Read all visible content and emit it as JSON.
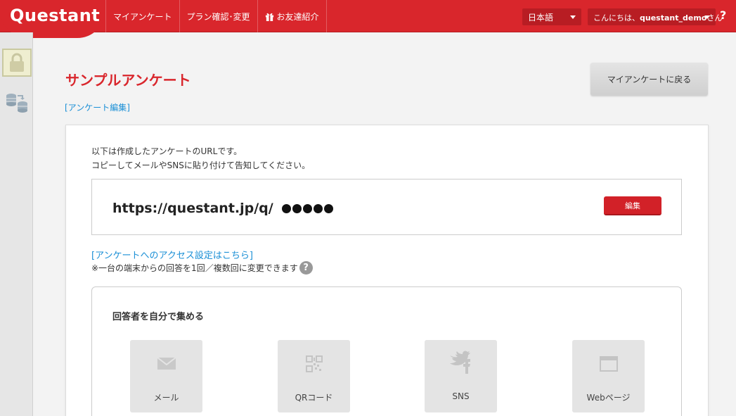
{
  "header": {
    "logo": "Questant",
    "nav": [
      {
        "label": "マイアンケート"
      },
      {
        "label": "プラン確認･変更"
      },
      {
        "label": "お友達紹介"
      }
    ],
    "language": "日本語",
    "user_greeting_prefix": "こんにちは、",
    "user_name": "questant_demo",
    "user_greeting_suffix": "さん",
    "help": "?"
  },
  "sidebar": {
    "items": [
      {
        "icon": "lock-icon"
      },
      {
        "icon": "database-transfer-icon"
      }
    ]
  },
  "main": {
    "title": "サンプルアンケート",
    "edit_link": "[アンケート編集]",
    "back_button": "マイアンケートに戻る",
    "intro_line1": "以下は作成したアンケートのURLです。",
    "intro_line2": "コピーしてメールやSNSに貼り付けて告知してください。",
    "url": "https://questant.jp/q/",
    "url_masked": "●●●●●",
    "url_edit_button": "編集",
    "access_link": "[アンケートへのアクセス設定はこちら]",
    "note": "※一台の端末からの回答を1回／複数回に変更できます",
    "collect_title": "回答者を自分で集める",
    "channels": [
      {
        "label": "メール",
        "icon": "mail-icon"
      },
      {
        "label": "QRコード",
        "icon": "qr-code-icon"
      },
      {
        "label": "SNS",
        "icon": "twitter-facebook-icon"
      },
      {
        "label": "Webページ",
        "icon": "browser-window-icon"
      }
    ]
  },
  "colors": {
    "brand_red": "#d9262c",
    "link_blue": "#1a8fd6"
  }
}
